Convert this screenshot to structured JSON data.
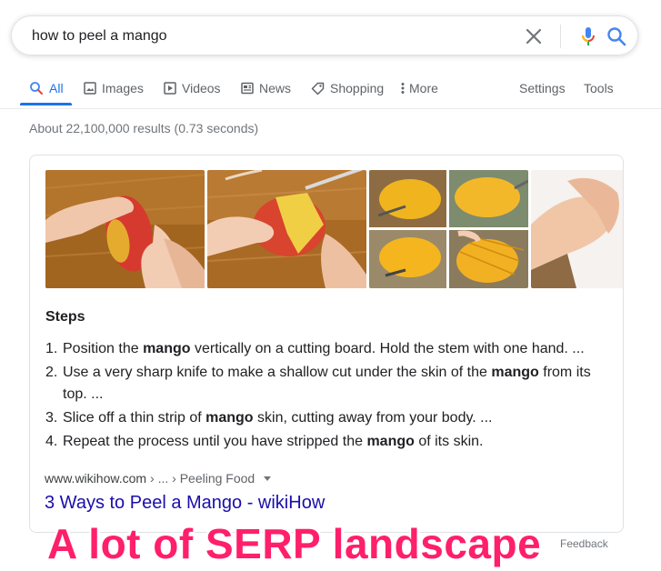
{
  "search": {
    "query": "how to peel a mango"
  },
  "tabs": [
    {
      "label": "All",
      "icon": "search-icon",
      "active": true
    },
    {
      "label": "Images",
      "icon": "image-icon"
    },
    {
      "label": "Videos",
      "icon": "video-icon"
    },
    {
      "label": "News",
      "icon": "news-icon"
    },
    {
      "label": "Shopping",
      "icon": "tag-icon"
    },
    {
      "label": "More",
      "icon": "more-vert-icon"
    }
  ],
  "tools": {
    "settings": "Settings",
    "tools": "Tools"
  },
  "result_stats": "About 22,100,000 results (0.73 seconds)",
  "featured_snippet": {
    "images": [
      "mango-held-on-board",
      "mango-being-peeled",
      "mango-peeling-collage",
      "hand-holding-mango"
    ],
    "title": "Steps",
    "steps": [
      {
        "num": "1.",
        "pre": "Position the ",
        "bold": "mango",
        "post": " vertically on a cutting board. Hold the stem with one hand. ..."
      },
      {
        "num": "2.",
        "pre": "Use a very sharp knife to make a shallow cut under the skin of the ",
        "bold": "mango",
        "post": " from its top. ..."
      },
      {
        "num": "3.",
        "pre": "Slice off a thin strip of ",
        "bold": "mango",
        "post": " skin, cutting away from your body. ..."
      },
      {
        "num": "4.",
        "pre": "Repeat the process until you have stripped the ",
        "bold": "mango",
        "post": " of its skin."
      }
    ],
    "cite_domain": "www.wikihow.com",
    "cite_path": " › ... › Peeling Food",
    "link_title": "3 Ways to Peel a Mango - wikiHow"
  },
  "feedback": "Feedback",
  "overlay_caption": "A lot of SERP landscape",
  "colors": {
    "accent": "#1a73e8",
    "link": "#1a0dab",
    "overlay": "#ff1f6b"
  }
}
